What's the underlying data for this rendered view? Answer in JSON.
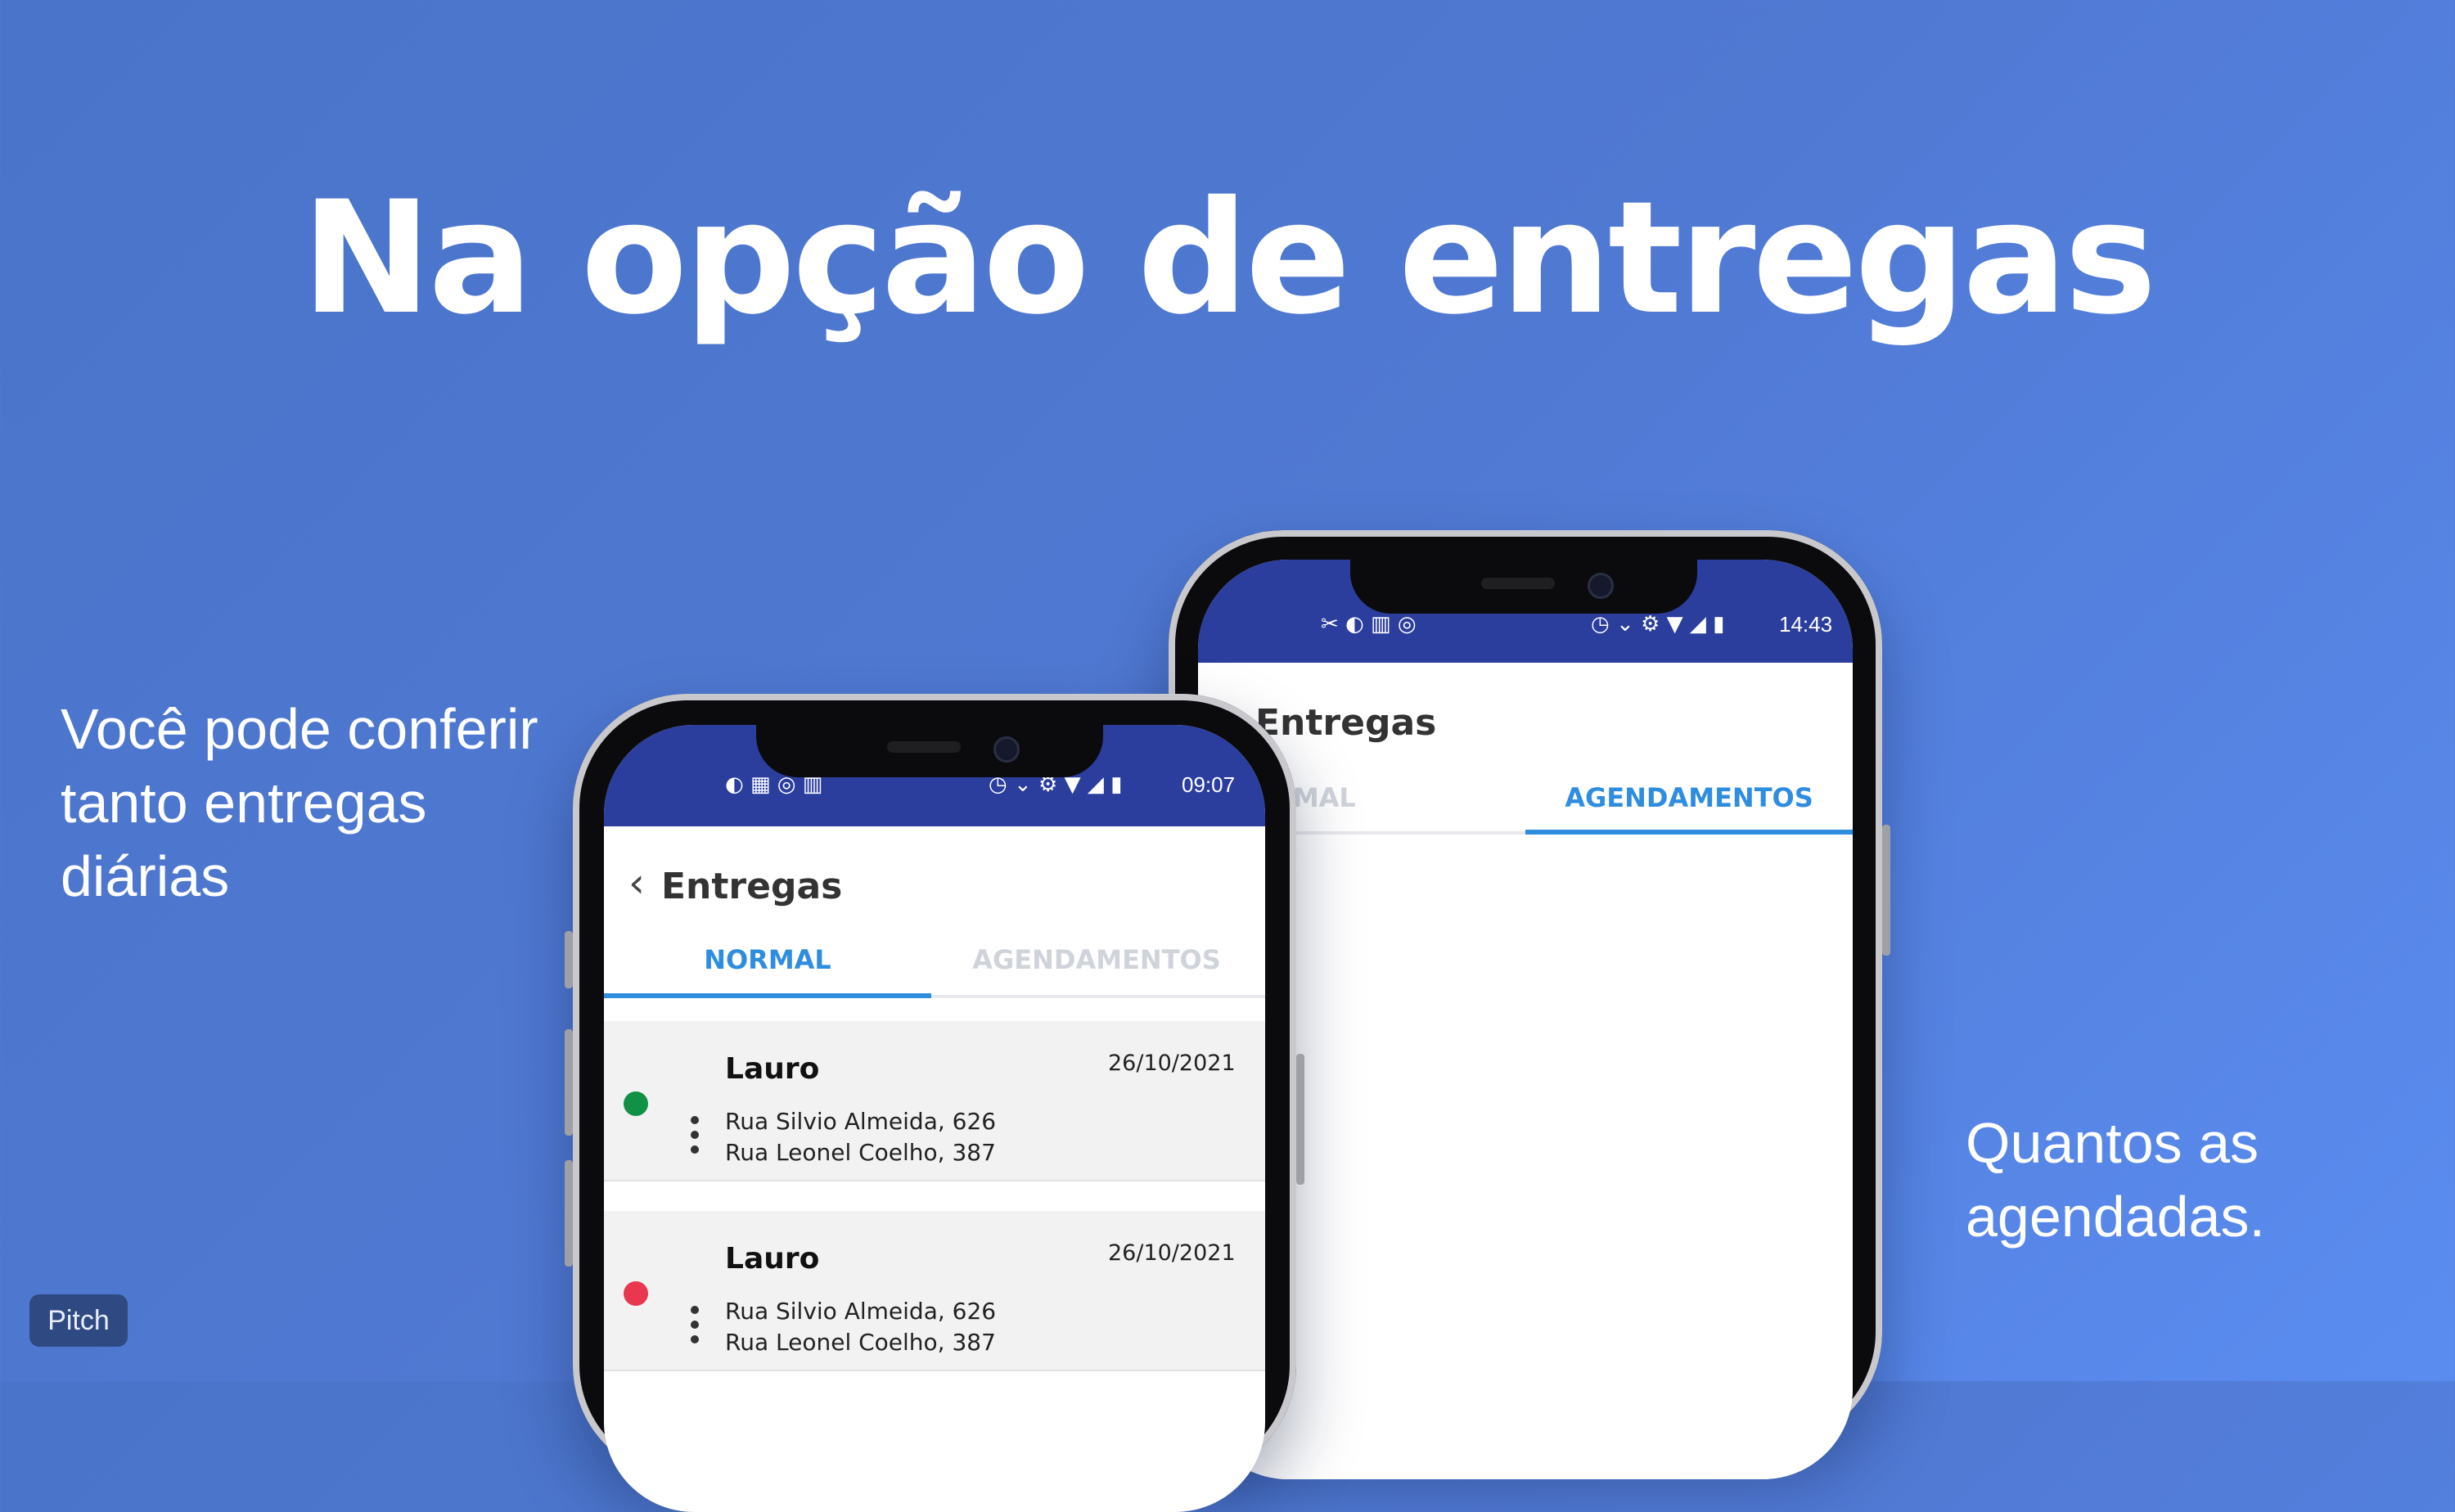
{
  "slide": {
    "headline": "Na opção de entregas",
    "left_text": "Você pode conferir tanto entregas diárias",
    "right_text": "Quantos as agendadas.",
    "badge": "Pitch"
  },
  "phone_front": {
    "status_time": "09:07",
    "status_icons": "◐ ▦ ◎ ▥",
    "status_right_icons": "◷ ⌄ ⚙ ▼ ◢ ▮",
    "title": "Entregas",
    "tabs": [
      {
        "label": "NORMAL",
        "active": true
      },
      {
        "label": "AGENDAMENTOS",
        "active": false
      }
    ],
    "deliveries": [
      {
        "name": "Lauro",
        "date": "26/10/2021",
        "address1": "Rua Silvio Almeida, 626",
        "address2": "Rua Leonel Coelho, 387",
        "status_color": "#119146"
      },
      {
        "name": "Lauro",
        "date": "26/10/2021",
        "address1": "Rua Silvio Almeida, 626",
        "address2": "Rua Leonel Coelho, 387",
        "status_color": "#e8374f"
      }
    ]
  },
  "phone_back": {
    "status_time": "14:43",
    "status_icons": "✂ ◐ ▥ ◎",
    "status_right_icons": "◷ ⌄ ⚙ ▼ ◢ ▮",
    "title": "Entregas",
    "tabs": [
      {
        "label": "NORMAL",
        "active": false
      },
      {
        "label": "AGENDAMENTOS",
        "active": true
      }
    ]
  },
  "colors": {
    "accent": "#2f8de0",
    "statusbar": "#2b3e9e",
    "background": "#5079d3"
  }
}
